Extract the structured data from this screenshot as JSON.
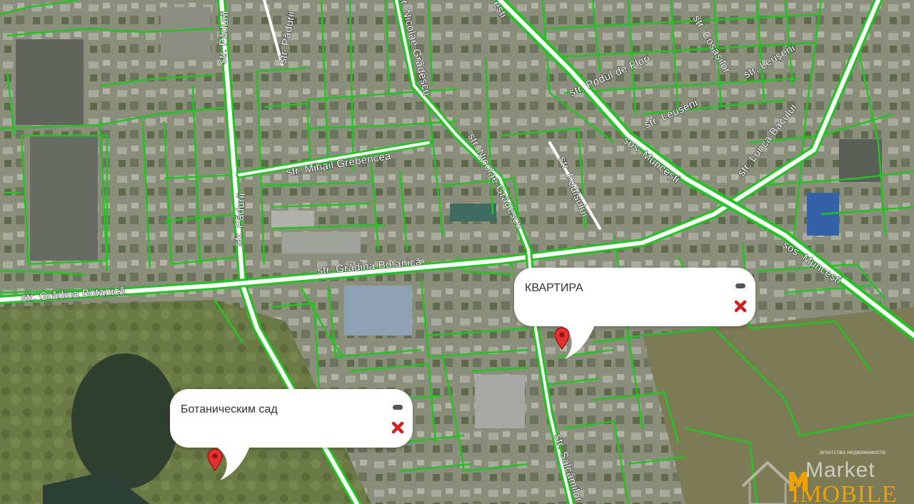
{
  "map": {
    "streets": {
      "padurii_vertical": "str. Pădurii",
      "padurii_top": "str. Pădurii",
      "nicolae_gradescu_top": "str. Nicolae Grădescu",
      "nicolae_gradescu_mid": "str. Nicolae Grădescu",
      "mihail_grebencea": "str. Mihail Grebencea",
      "gradina_botanica_left": "str. Grădina Botanică",
      "gradina_botanica_mid": "str. Grădina Botanică",
      "podisului": "str. Podișului",
      "podul_de_flori": "str. Podul de Flori",
      "cosasilor": "str. Cosașilor",
      "leuseni_1": "str. Leușeni",
      "leuseni_2": "str. Leușeni",
      "lunca_bacului": "str. Lunca Bâcului",
      "muncesti_upper": "șos. Muncești",
      "muncesti_lower": "șos. Muncești",
      "salcamilor": "str. Salcâmilor",
      "top_fragment": "ești"
    },
    "colors": {
      "parcel_lines": "#22c422",
      "road_fill": "#ffffff",
      "marker": "#e03030"
    }
  },
  "popups": [
    {
      "title": "КВАРТИРА",
      "minimize_icon": "minimize-icon",
      "close_icon": "close-x-icon"
    },
    {
      "title": "Ботаническим сад",
      "minimize_icon": "minimize-icon",
      "close_icon": "close-x-icon"
    }
  ],
  "logo": {
    "tagline": "агентство недвижимости",
    "brand_top": "Market",
    "brand_bottom": "IMOBILE",
    "accent": "#f0a000"
  }
}
